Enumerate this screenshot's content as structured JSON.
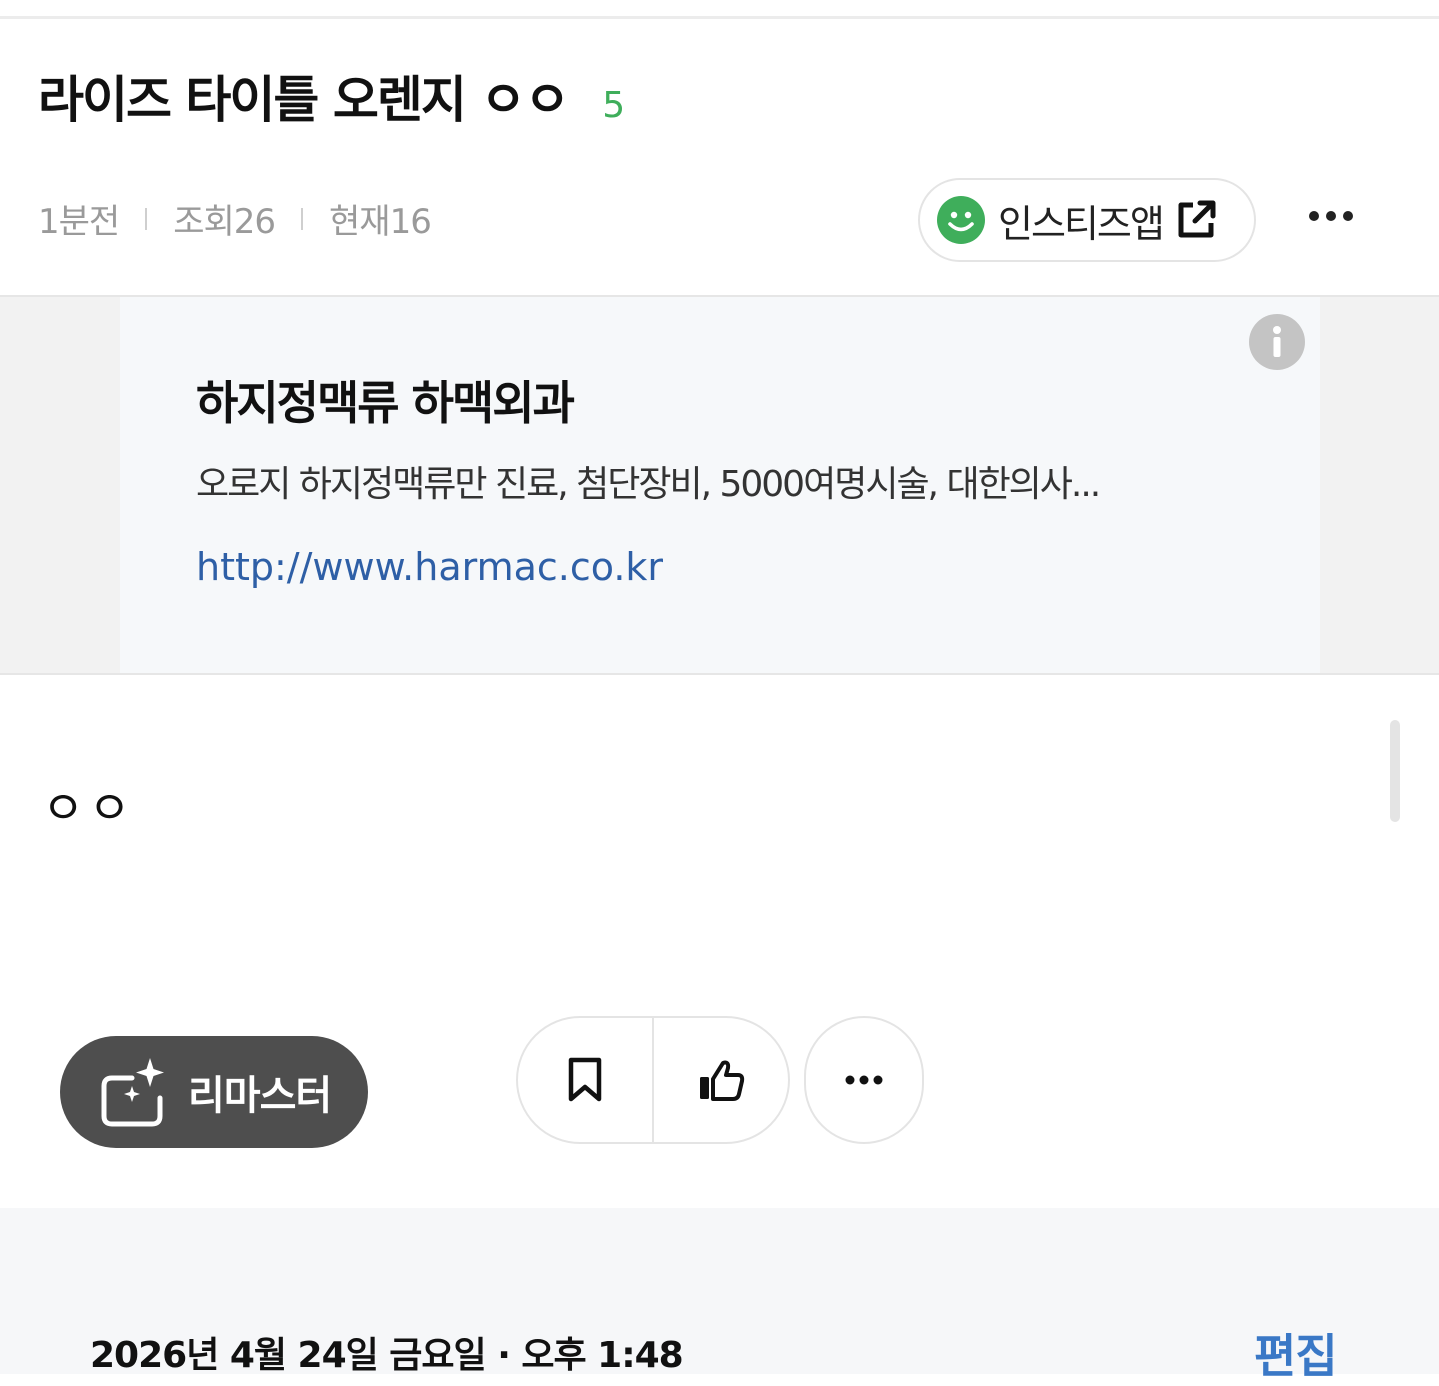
{
  "post": {
    "title": "라이즈 타이틀 오렌지 ㅇㅇ",
    "comment_count": "5",
    "time_ago": "1분전",
    "views": "조회26",
    "current": "현재16",
    "body": "ㅇㅇ"
  },
  "app_button": {
    "label": "인스티즈앱"
  },
  "ad": {
    "title": "하지정맥류 하맥외과",
    "description": "오로지 하지정맥류만 진료, 첨단장비, 5000여명시술, 대한의사...",
    "url": "http://www.harmac.co.kr"
  },
  "actions": {
    "remaster_label": "리마스터"
  },
  "footer": {
    "datetime": "2026년 4월 24일 금요일 · 오후 1:48",
    "edit_label": "편집"
  },
  "colors": {
    "accent_green": "#3fae5b",
    "link_blue": "#2e5fa6",
    "edit_blue": "#3a78c6",
    "remaster_bg": "#4e4e4e"
  },
  "icons": [
    "smile-icon",
    "external-link-icon",
    "more-icon",
    "info-icon",
    "sparkle-image-icon",
    "bookmark-icon",
    "thumbs-up-icon"
  ]
}
